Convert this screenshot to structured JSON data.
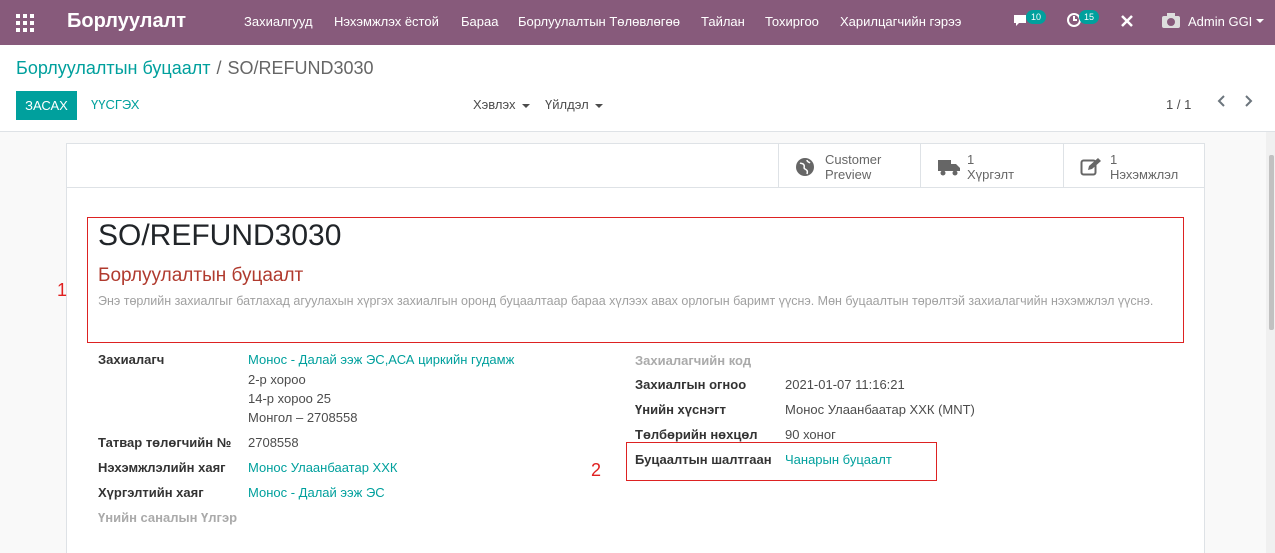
{
  "navbar": {
    "brand": "Борлуулалт",
    "menu": [
      "Захиалгууд",
      "Нэхэмжлэх ёстой",
      "Бараа",
      "Борлуулалтын Төлөвлөгөө",
      "Тайлан",
      "Тохиргоо",
      "Харилцагчийн гэрээ"
    ],
    "messages_count": "10",
    "activities_count": "15",
    "user": "Admin GGI",
    "icons": [
      "apps-icon",
      "chat-icon",
      "clock-icon",
      "tools-icon",
      "camera-icon"
    ]
  },
  "breadcrumb": {
    "parent": "Борлуулалтын буцаалт",
    "separator": "/",
    "current": "SO/REFUND3030"
  },
  "actions": {
    "edit": "ЗАСАХ",
    "create": "ҮҮСГЭХ",
    "print": "Хэвлэх",
    "action": "Үйлдэл"
  },
  "pager": {
    "value": "1 / 1"
  },
  "smart_buttons": [
    {
      "icon": "globe-icon",
      "line1": "Customer",
      "line2": "Preview"
    },
    {
      "icon": "truck-icon",
      "line1": "1",
      "line2": "Хүргэлт"
    },
    {
      "icon": "invoice-icon",
      "line1": "1",
      "line2": "Нэхэмжлэл"
    }
  ],
  "document": {
    "name": "SO/REFUND3030",
    "type": "Борлуулалтын буцаалт",
    "description": "Энэ төрлийн захиалгыг батлахад агуулахын хүргэх захиалгын оронд буцаалтаар бараа хүлээх авах орлогын баримт үүснэ. Мөн буцаалтын төрөлтэй захиалагчийн нэхэмжлэл үүснэ."
  },
  "markers": {
    "m1": "1",
    "m2": "2"
  },
  "left_fields": {
    "customer_label": "Захиалагч",
    "customer_value": "Монос - Далай ээж ЭС,АСА циркийн гудамж",
    "address": [
      "2-р хороо",
      "14-р хороо 25",
      "Монгол – 2708558"
    ],
    "tax_label": "Татвар төлөгчийн №",
    "tax_value": "2708558",
    "invoice_addr_label": "Нэхэмжлэлийн хаяг",
    "invoice_addr_value": "Монос Улаанбаатар ХХК",
    "delivery_addr_label": "Хүргэлтийн хаяг",
    "delivery_addr_value": "Монос - Далай ээж ЭС",
    "pricelist_label": "Үнийн саналын Үлгэр"
  },
  "right_fields": {
    "customer_code_label": "Захиалагчийн код",
    "order_date_label": "Захиалгын огноо",
    "order_date_value": "2021-01-07 11:16:21",
    "pricelist_label": "Үнийн хүснэгт",
    "pricelist_value": "Монос Улаанбаатар ХХК (MNT)",
    "payment_terms_label": "Төлбөрийн нөхцөл",
    "payment_terms_value": "90 хоног",
    "return_reason_label": "Буцаалтын шалтгаан",
    "return_reason_value": "Чанарын буцаалт"
  }
}
